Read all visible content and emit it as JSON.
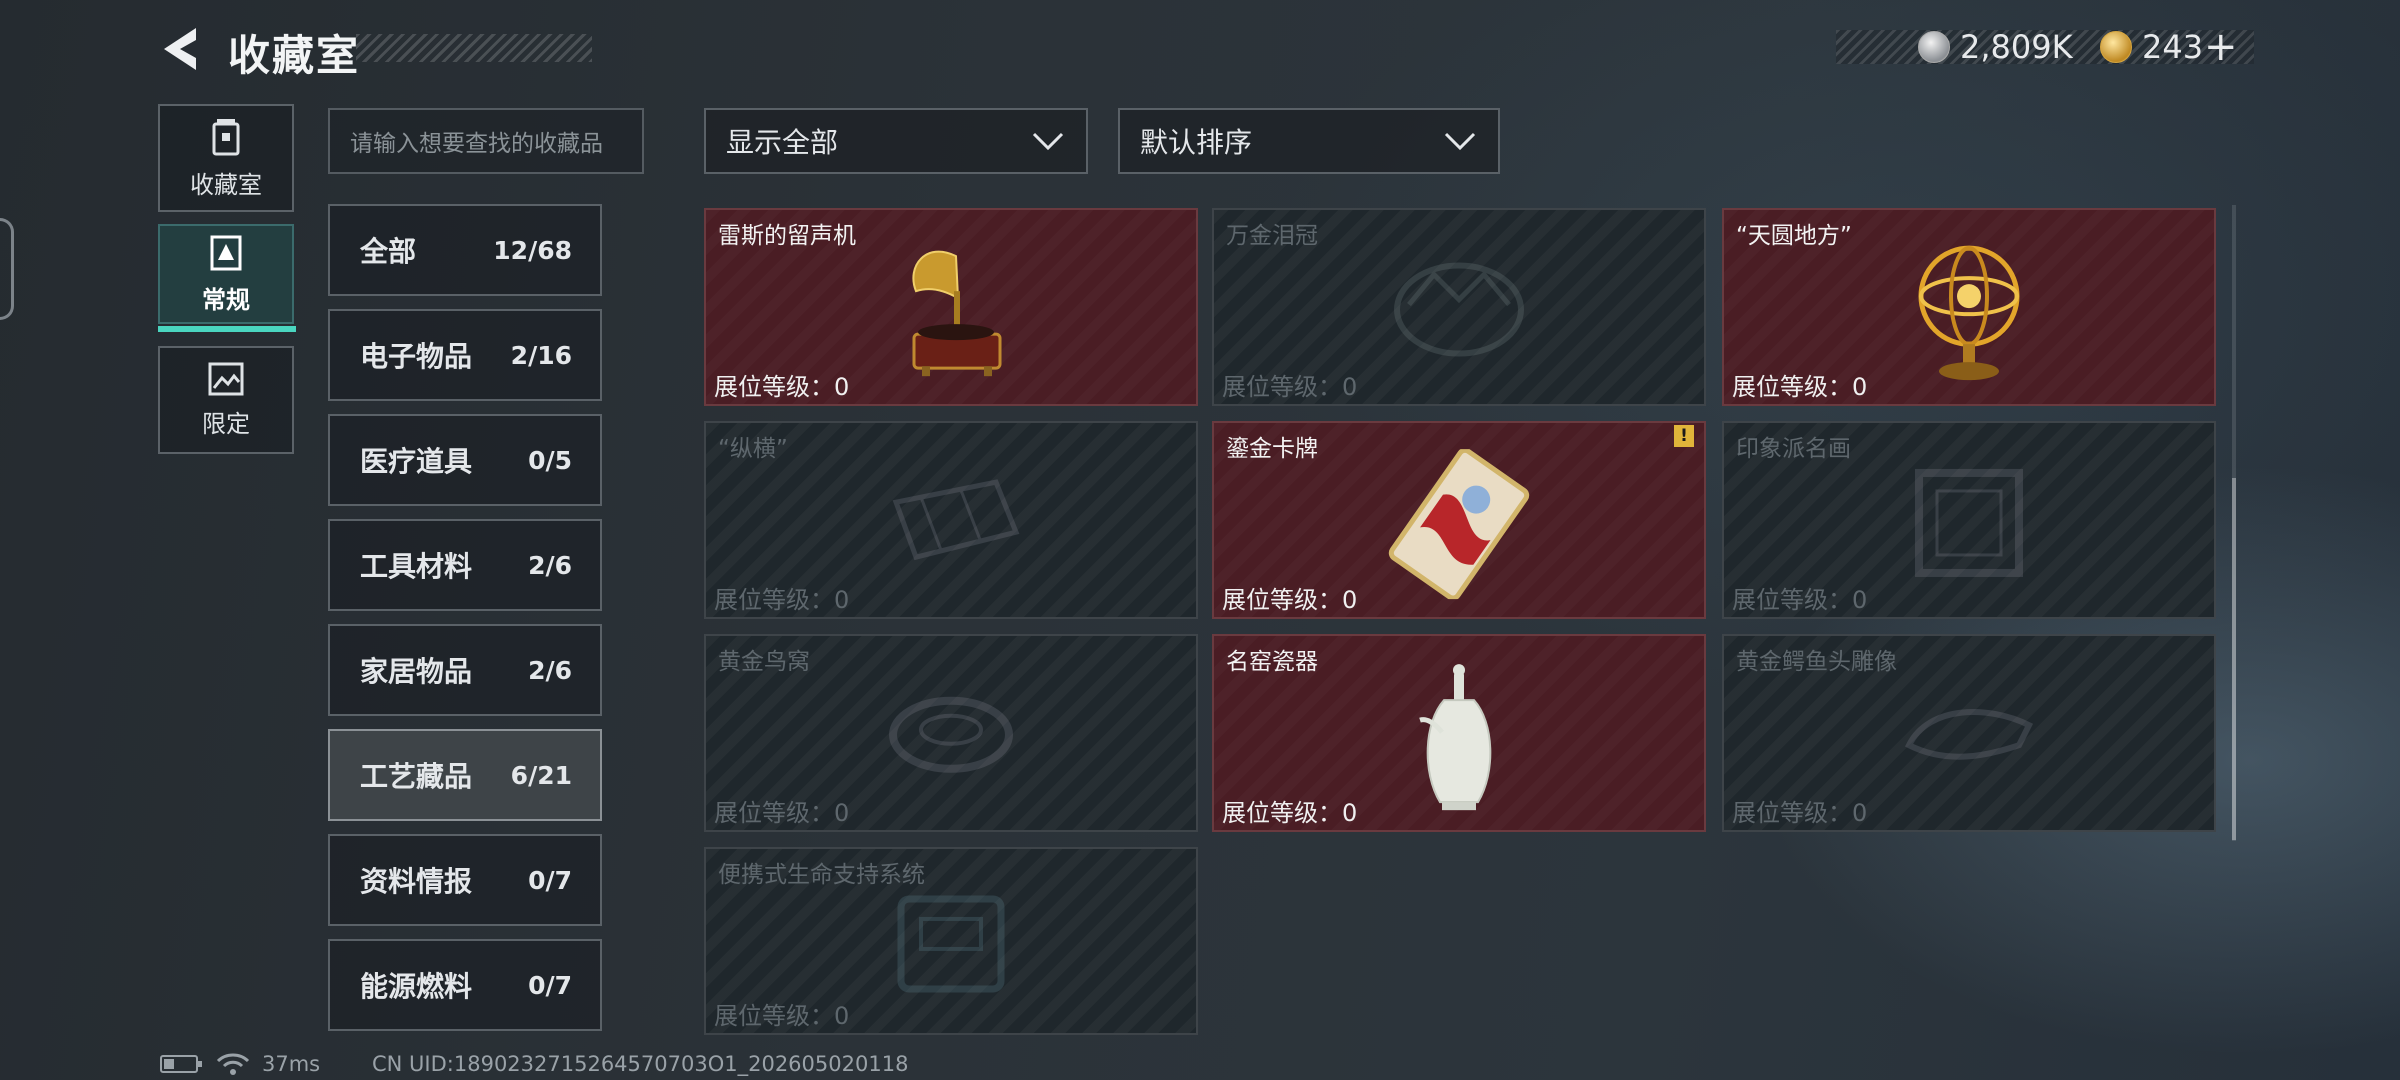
{
  "header": {
    "title": "收藏室"
  },
  "currency": {
    "silver": "2,809K",
    "gold": "243",
    "add": "+"
  },
  "side_nav": [
    {
      "label": "收藏室",
      "icon": "trash-can-icon"
    },
    {
      "label": "常规",
      "icon": "document-icon",
      "active": true
    },
    {
      "label": "限定",
      "icon": "picture-icon"
    }
  ],
  "search": {
    "placeholder": "请输入想要查找的收藏品"
  },
  "categories": [
    {
      "name": "全部",
      "count": "12/68"
    },
    {
      "name": "电子物品",
      "count": "2/16"
    },
    {
      "name": "医疗道具",
      "count": "0/5"
    },
    {
      "name": "工具材料",
      "count": "2/6"
    },
    {
      "name": "家居物品",
      "count": "2/6"
    },
    {
      "name": "工艺藏品",
      "count": "6/21",
      "active": true
    },
    {
      "name": "资料情报",
      "count": "0/7"
    },
    {
      "name": "能源燃料",
      "count": "0/7"
    }
  ],
  "filters": {
    "show": "显示全部",
    "sort": "默认排序"
  },
  "display_label": "展位等级：",
  "items": [
    {
      "name": "雷斯的留声机",
      "level": "0",
      "owned": true,
      "icon": "gramophone-icon"
    },
    {
      "name": "万金泪冠",
      "level": "0",
      "owned": false,
      "icon": "crown-icon"
    },
    {
      "name": "“天圆地方”",
      "level": "0",
      "owned": true,
      "icon": "armillary-sphere-icon"
    },
    {
      "name": "“纵横”",
      "level": "0",
      "owned": false,
      "icon": "chessboard-icon"
    },
    {
      "name": "鎏金卡牌",
      "level": "0",
      "owned": true,
      "icon": "gilded-card-icon",
      "alert": "!"
    },
    {
      "name": "印象派名画",
      "level": "0",
      "owned": false,
      "icon": "painting-icon"
    },
    {
      "name": "黄金鸟窝",
      "level": "0",
      "owned": false,
      "icon": "bird-nest-icon"
    },
    {
      "name": "名窑瓷器",
      "level": "0",
      "owned": true,
      "icon": "porcelain-vase-icon"
    },
    {
      "name": "黄金鳄鱼头雕像",
      "level": "0",
      "owned": false,
      "icon": "crocodile-head-icon"
    },
    {
      "name": "便携式生命支持系统",
      "level": "0",
      "owned": false,
      "icon": "life-support-icon"
    }
  ],
  "footer": {
    "ping": "37ms",
    "uid": "CN UID:1890232715264570703О1_202605020118"
  }
}
